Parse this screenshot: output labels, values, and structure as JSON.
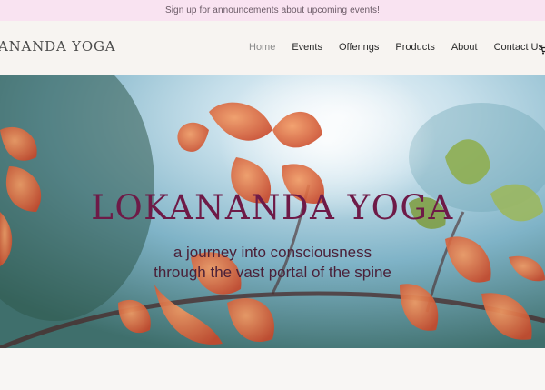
{
  "announcement": {
    "text": "Sign up for announcements about upcoming events!"
  },
  "header": {
    "logo": "ANANDA YOGA",
    "nav": [
      {
        "label": "Home"
      },
      {
        "label": "Events"
      },
      {
        "label": "Offerings"
      },
      {
        "label": "Products"
      },
      {
        "label": "About"
      },
      {
        "label": "Contact Us"
      }
    ],
    "cart_icon": "cart-icon"
  },
  "hero": {
    "title": "LOKANANDA YOGA",
    "tagline_line1": "a journey into consciousness",
    "tagline_line2": "through the vast portal of the spine"
  },
  "colors": {
    "announcement_bg": "#f9e3f1",
    "title_color": "#6e1a47",
    "flower_orange": "#e0602b"
  }
}
